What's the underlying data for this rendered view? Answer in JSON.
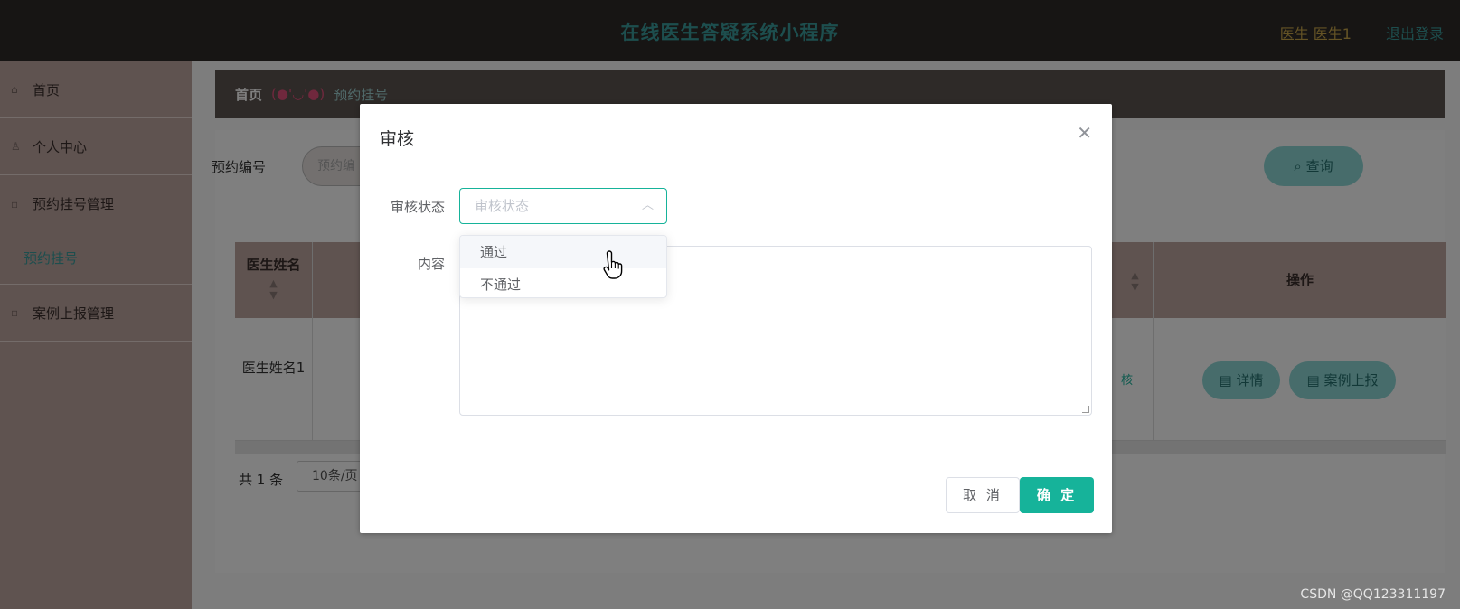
{
  "header": {
    "title": "在线医生答疑系统小程序",
    "user": "医生 医生1",
    "logout": "退出登录"
  },
  "sidebar": {
    "items": [
      {
        "label": "首页",
        "icon": "home-icon"
      },
      {
        "label": "个人中心",
        "icon": "user-icon"
      },
      {
        "label": "预约挂号管理",
        "icon": "menu-icon"
      },
      {
        "label": "案例上报管理",
        "icon": "menu-icon"
      }
    ],
    "sub_item": "预约挂号"
  },
  "breadcrumb": {
    "home": "首页",
    "separator": "(●'◡'●)",
    "current": "预约挂号"
  },
  "search": {
    "label": "预约编号",
    "placeholder": "预约编",
    "query_button": "查询"
  },
  "table": {
    "headers": [
      "医生姓名",
      "操作"
    ],
    "row": {
      "doctor_name": "医生姓名1",
      "status_fragment": "核",
      "detail_button": "详情",
      "report_button": "案例上报"
    }
  },
  "pagination": {
    "total": "共 1 条",
    "page_size": "10条/页"
  },
  "dialog": {
    "title": "审核",
    "status_label": "审核状态",
    "status_placeholder": "审核状态",
    "content_label": "内容",
    "options": [
      "通过",
      "不通过"
    ],
    "cancel": "取 消",
    "confirm": "确 定"
  },
  "watermark": "CSDN @QQ123311197",
  "colors": {
    "accent": "#16b39a",
    "header_bg": "#2e2b29",
    "sidebar_bg": "#bfa7a1"
  }
}
